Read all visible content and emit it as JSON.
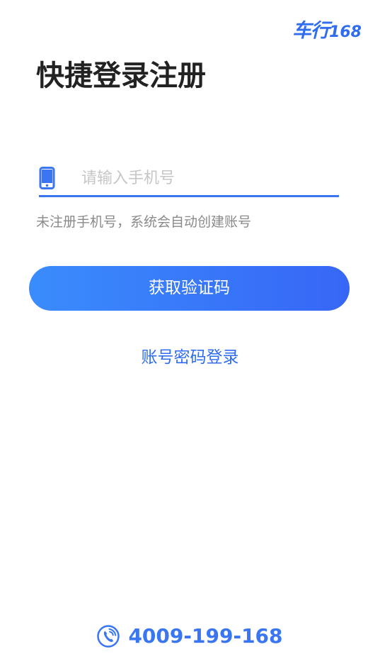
{
  "brand": {
    "logo_text": "车行",
    "logo_number": "168",
    "accent_color": "#2f6cf0"
  },
  "header": {
    "title": "快捷登录注册"
  },
  "phone_field": {
    "icon": "mobile-phone-icon",
    "placeholder": "请输入手机号",
    "value": ""
  },
  "hint": {
    "text": "未注册手机号，系统会自动创建账号"
  },
  "get_code_button": {
    "label": "获取验证码"
  },
  "password_login_link": {
    "label": "账号密码登录"
  },
  "footer": {
    "icon": "phone-call-icon",
    "hotline": "4009-199-168"
  }
}
